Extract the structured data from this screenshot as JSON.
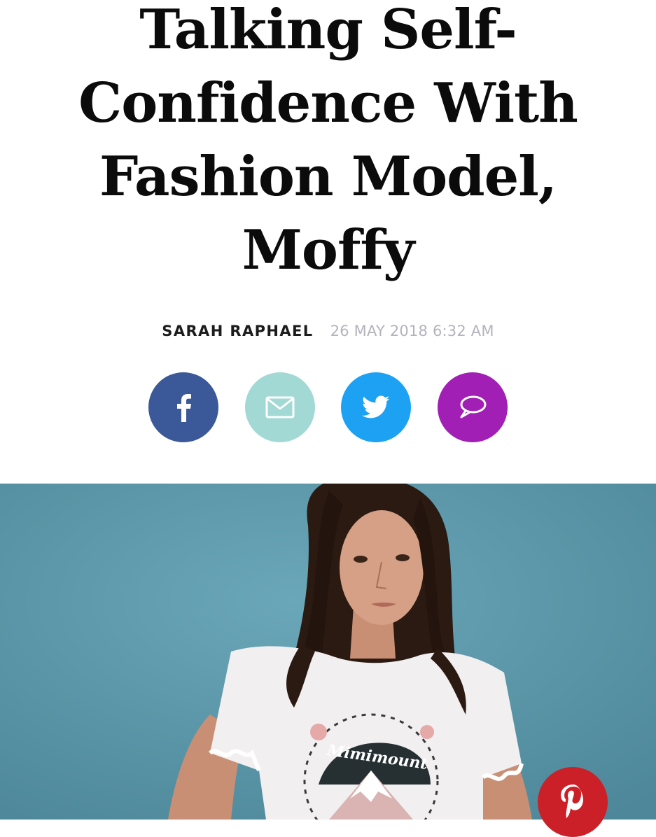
{
  "article": {
    "title_lines": [
      "Talking Self-",
      "Confidence With",
      "Fashion Model,",
      "Moffy"
    ],
    "author": "SARAH RAPHAEL",
    "date": "26 MAY 2018 6:32 AM"
  },
  "share": {
    "buttons": [
      {
        "name": "facebook",
        "icon": "facebook-icon",
        "color": "#3b5998"
      },
      {
        "name": "email",
        "icon": "envelope-icon",
        "color": "#a2d9d4"
      },
      {
        "name": "twitter",
        "icon": "twitter-bird-icon",
        "color": "#1da1f2"
      },
      {
        "name": "comments",
        "icon": "speech-bubble-icon",
        "color": "#a11fb5"
      }
    ]
  },
  "hero": {
    "shirt_print": "Mimimount",
    "background_color": "#5a96a8"
  },
  "pinterest": {
    "icon": "pinterest-icon",
    "color": "#cb2027"
  }
}
